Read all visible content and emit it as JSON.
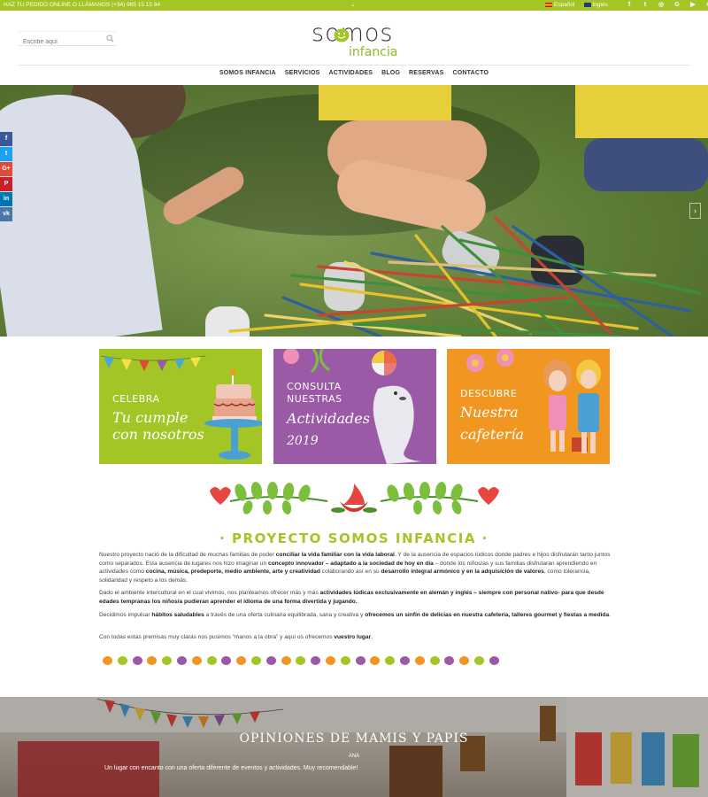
{
  "topbar": {
    "promo": "HAZ TU PEDIDO ONLINE O LLÁMANOS (+34) 965 15 15 84",
    "languages": [
      {
        "label": "Español",
        "flag": "flag-es"
      },
      {
        "label": "Inglés",
        "flag": "flag-en"
      }
    ],
    "social": [
      {
        "icon": "facebook-icon",
        "glyph": "f"
      },
      {
        "icon": "twitter-icon",
        "glyph": "t"
      },
      {
        "icon": "instagram-icon",
        "glyph": "◎"
      },
      {
        "icon": "google-plus-icon",
        "glyph": "G"
      },
      {
        "icon": "youtube-icon",
        "glyph": "▶"
      },
      {
        "icon": "rss-icon",
        "glyph": "≋"
      }
    ]
  },
  "search": {
    "placeholder": "Escribe aquí"
  },
  "logo": {
    "line1": "somos",
    "line2": "infancia"
  },
  "nav": [
    "SOMOS INFANCIA",
    "SERVICIOS",
    "ACTIVIDADES",
    "BLOG",
    "RESERVAS",
    "CONTACTO"
  ],
  "share": [
    {
      "icon": "facebook-share-icon",
      "glyph": "f",
      "color": "#3b5998"
    },
    {
      "icon": "twitter-share-icon",
      "glyph": "t",
      "color": "#1da1f2"
    },
    {
      "icon": "google-share-icon",
      "glyph": "G+",
      "color": "#dd4b39"
    },
    {
      "icon": "pinterest-share-icon",
      "glyph": "P",
      "color": "#cb2027"
    },
    {
      "icon": "linkedin-share-icon",
      "glyph": "in",
      "color": "#0077b5"
    },
    {
      "icon": "vk-share-icon",
      "glyph": "vk",
      "color": "#4a76a8"
    }
  ],
  "cards": [
    {
      "small": "CELEBRA",
      "big1": "Tu cumple",
      "big2": "con nosotros"
    },
    {
      "small1": "CONSULTA",
      "small2": "NUESTRAS",
      "big1": "Actividades",
      "big2": "2019"
    },
    {
      "small": "DESCUBRE",
      "big1": "Nuestra",
      "big2": "cafetería"
    }
  ],
  "project": {
    "title": "· PROYECTO SOMOS INFANCIA ·",
    "p1a": "Nuestro proyecto nació de la dificultad de muchas familias de poder ",
    "p1b": "conciliar la vida familiar con la vida laboral",
    "p1c": ". Y de la ausencia de espacios lúdicos donde padres e hijos disfrutarán tanto juntos como separados. Esta ausencia de lugares nos hizo imaginar un ",
    "p1d": "concepto innovador – adaptado a la sociedad de hoy en día",
    "p1e": " – donde los niños/as y sus familias disfrutaran aprendiendo en actividades como ",
    "p1f": "cocina, música, predeporte, medio ambiente, arte y creatividad",
    "p1g": " colaborando así en su ",
    "p1h": "desarrollo integral armónico y en la adquisición de valores",
    "p1i": ", como tolerancia, solidaridad y respeto a los demás.",
    "p2a": "Dado el ambiente intercultural en el cual vivimos, nos planteamos ofrecer más y más ",
    "p2b": "actividades lúdicas exclusivamente en alemán y inglés – siempre con personal nativo- para que desde edades tempranas los niños/a pudieran aprender el idioma de una forma divertida y jugando.",
    "p3a": "Decidimos impulsar ",
    "p3b": "hábitos saludables",
    "p3c": " a través de  una oferta culinaria equilibrada, sana y creativa y ",
    "p3d": "ofrecemos un sinfín de delicias en nuestra cafetería, talleres gourmet y fiestas a medida",
    "p3e": ".",
    "p4a": "Con todas estas premisas muy claras nos pusimos “manos a la obra” y aquí os ofrecemos ",
    "p4b": "vuestro lugar",
    "p4c": "."
  },
  "dot_colors": [
    "#f19721",
    "#a3c626",
    "#9a5aa6"
  ],
  "testimonials": {
    "title": "OPINIONES DE MAMIS Y PAPIS",
    "name": "ANA",
    "quote": "Un lugar con encanto con una oferta diferente de eventos y actividades. Muy recomendable!"
  },
  "colors": {
    "brand_green": "#a3c626",
    "purple": "#9a5aa6",
    "orange": "#f19721"
  }
}
